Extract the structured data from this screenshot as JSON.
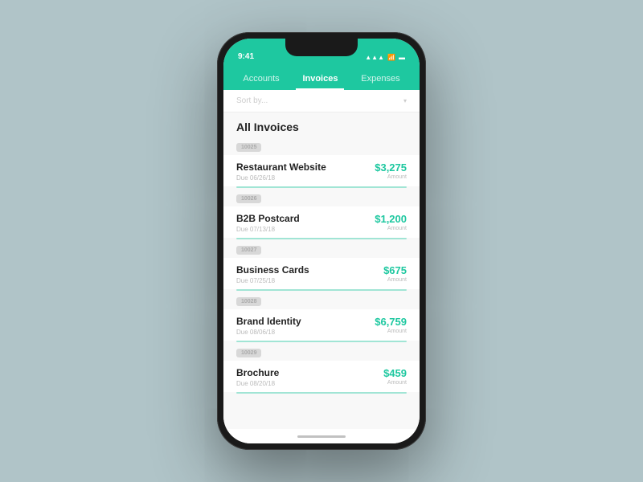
{
  "statusBar": {
    "time": "9:41",
    "signal": "▲▲▲",
    "wifi": "WiFi",
    "battery": "Battery"
  },
  "tabs": [
    {
      "label": "Accounts",
      "active": false
    },
    {
      "label": "Invoices",
      "active": true
    },
    {
      "label": "Expenses",
      "active": false
    }
  ],
  "sort": {
    "placeholder": "Sort by...",
    "arrow": "▾"
  },
  "sectionTitle": "All Invoices",
  "invoices": [
    {
      "id": "10025",
      "name": "Restaurant Website",
      "due": "Due 06/26/18",
      "amount": "$3,275",
      "amountLabel": "Amount"
    },
    {
      "id": "10026",
      "name": "B2B Postcard",
      "due": "Due 07/13/18",
      "amount": "$1,200",
      "amountLabel": "Amount"
    },
    {
      "id": "10027",
      "name": "Business Cards",
      "due": "Due 07/25/18",
      "amount": "$675",
      "amountLabel": "Amount"
    },
    {
      "id": "10028",
      "name": "Brand Identity",
      "due": "Due 08/06/18",
      "amount": "$6,759",
      "amountLabel": "Amount"
    },
    {
      "id": "10029",
      "name": "Brochure",
      "due": "Due 08/20/18",
      "amount": "$459",
      "amountLabel": "Amount"
    }
  ],
  "colors": {
    "accent": "#1ec8a0"
  }
}
